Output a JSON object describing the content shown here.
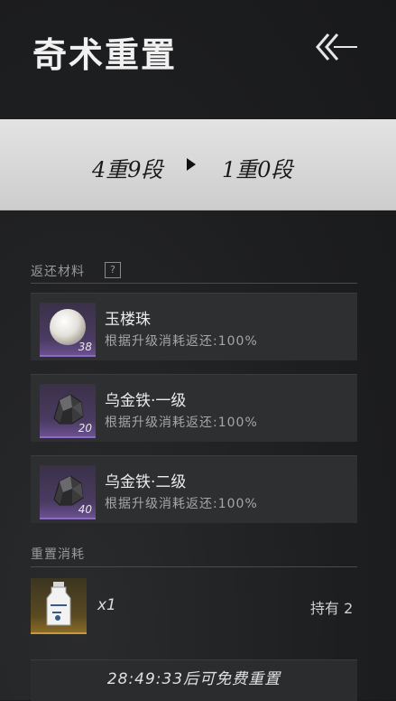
{
  "header": {
    "title": "奇术重置",
    "back_icon": "back-arrow-icon"
  },
  "level_change": {
    "from": "4重9段",
    "to": "1重0段"
  },
  "refund": {
    "label": "返还材料",
    "help": "?",
    "items": [
      {
        "name": "玉楼珠",
        "desc": "根据升级消耗返还:100%",
        "count": "38",
        "icon": "pearl-icon"
      },
      {
        "name": "乌金铁·一级",
        "desc": "根据升级消耗返还:100%",
        "count": "20",
        "icon": "ore-icon"
      },
      {
        "name": "乌金铁·二级",
        "desc": "根据升级消耗返还:100%",
        "count": "40",
        "icon": "ore-icon"
      }
    ]
  },
  "cost": {
    "label": "重置消耗",
    "quantity": "x1",
    "owned": "持有 2",
    "icon": "potion-bottle-icon"
  },
  "reset_button": {
    "label": "28:49:33后可免费重置"
  },
  "colors": {
    "background": "#1f2022",
    "banner": "#d9d9d9",
    "purple_rarity": "#8a6bc0",
    "gold_rarity": "#c49a3a"
  }
}
